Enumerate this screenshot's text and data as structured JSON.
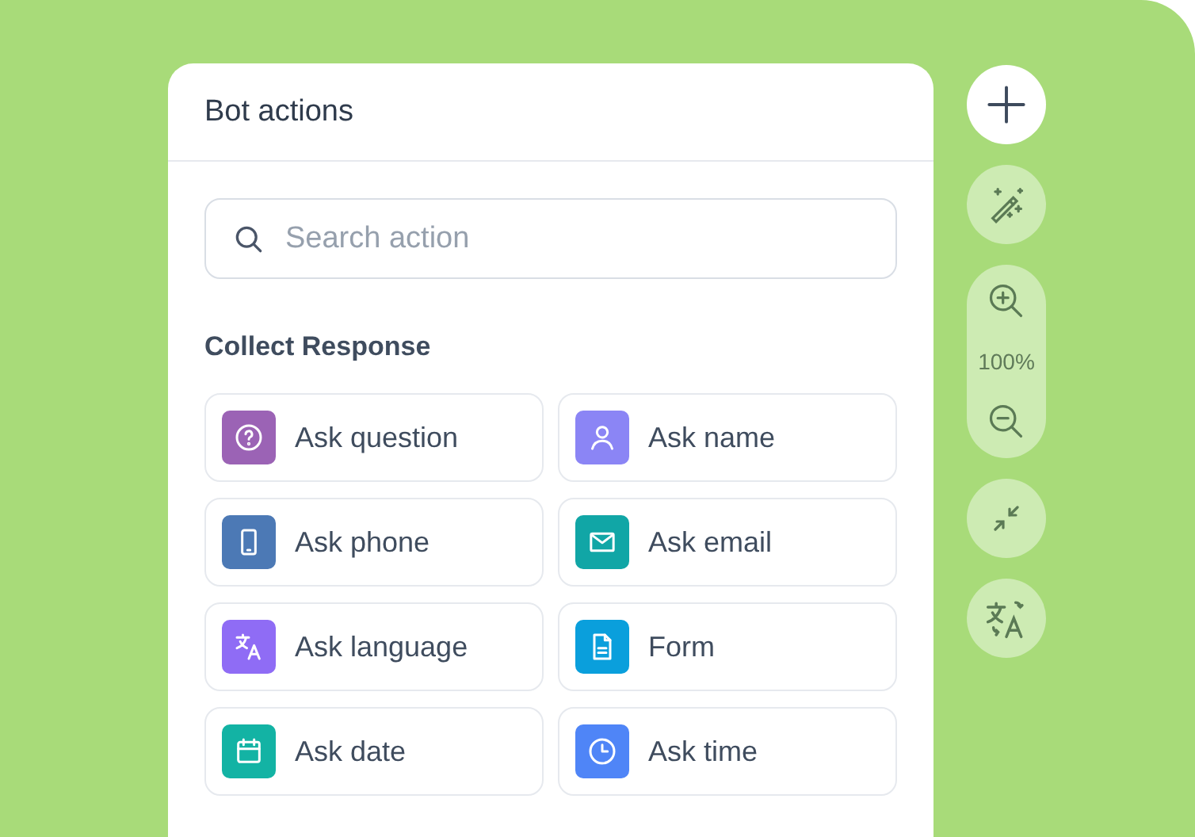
{
  "panel": {
    "title": "Bot actions",
    "search": {
      "placeholder": "Search action"
    },
    "section_title": "Collect Response",
    "actions": [
      {
        "label": "Ask question",
        "color": "#9b63b5"
      },
      {
        "label": "Ask name",
        "color": "#8b85f5"
      },
      {
        "label": "Ask phone",
        "color": "#4c79b5"
      },
      {
        "label": "Ask email",
        "color": "#11a6a6"
      },
      {
        "label": "Ask language",
        "color": "#8f6cf5"
      },
      {
        "label": "Form",
        "color": "#0a9fdc"
      },
      {
        "label": "Ask date",
        "color": "#13b3a4"
      },
      {
        "label": "Ask time",
        "color": "#4f85f7"
      }
    ]
  },
  "toolbar": {
    "zoom": "100%"
  }
}
